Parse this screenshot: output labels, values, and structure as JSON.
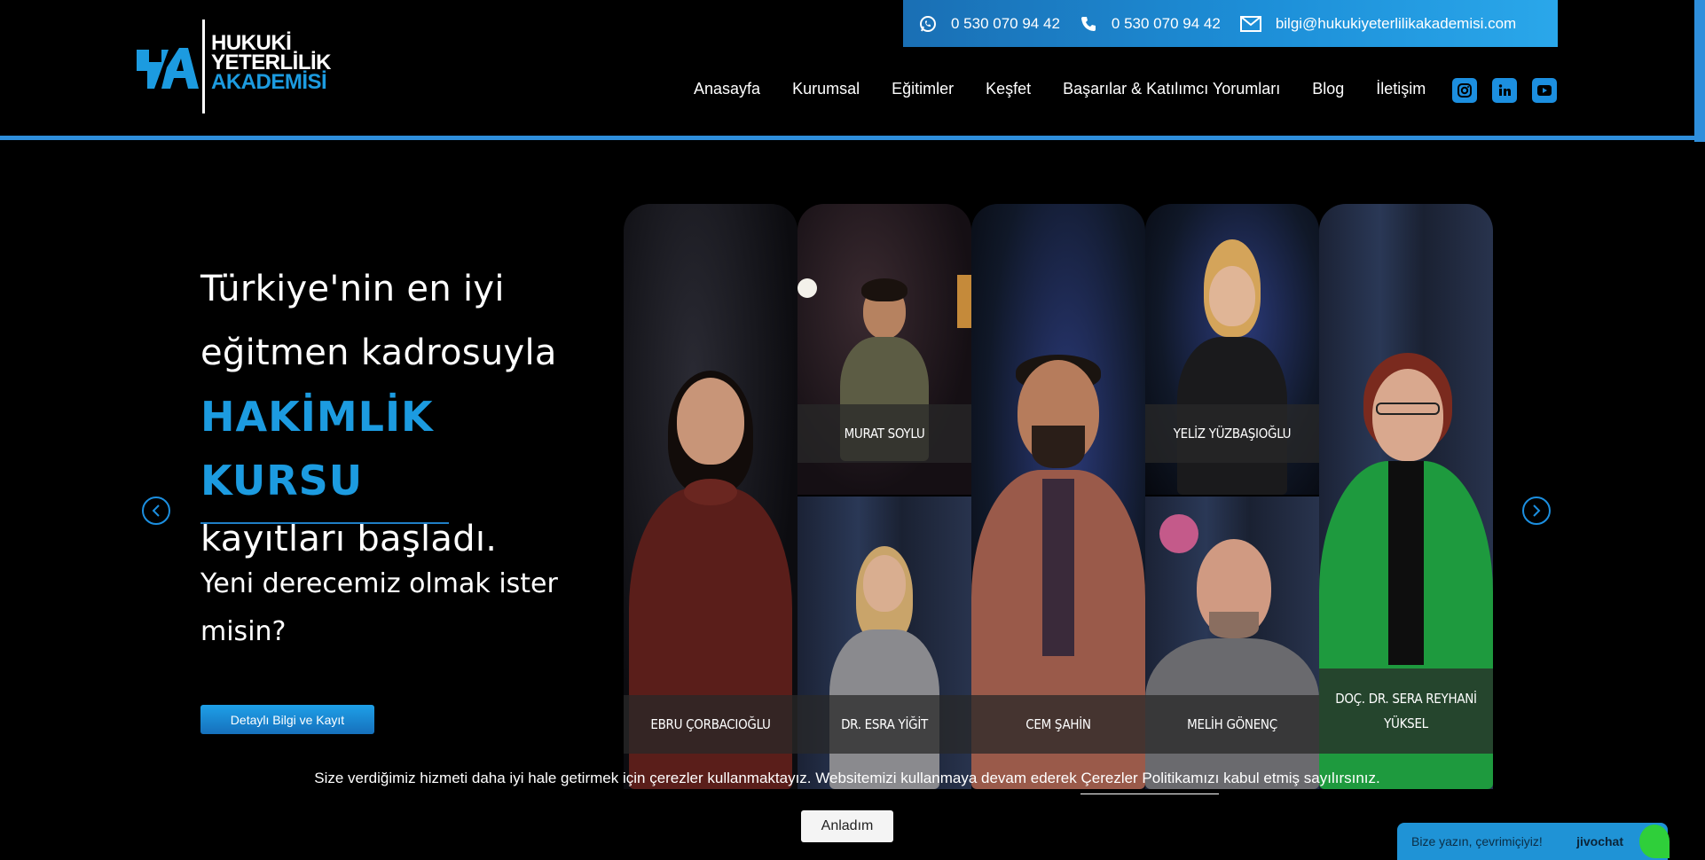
{
  "brand": {
    "logo_lines": [
      "HUKUKİ",
      "YETERLİLİK",
      "AKADEMİSİ"
    ],
    "accent_color": "#1c9be0"
  },
  "contact": {
    "whatsapp": "0 530 070 94 42",
    "phone": "0 530 070 94 42",
    "email": "bilgi@hukukiyeterlilikakademisi.com"
  },
  "nav": {
    "items": [
      "Anasayfa",
      "Kurumsal",
      "Eğitimler",
      "Keşfet",
      "Başarılar & Katılımcı Yorumları",
      "Blog",
      "İletişim"
    ]
  },
  "social": [
    "instagram-icon",
    "linkedin-icon",
    "youtube-icon"
  ],
  "hero": {
    "line1": "Türkiye'nin en iyi",
    "line2": "eğitmen kadrosuyla",
    "accent": "HAKİMLİK KURSU",
    "line3": "kayıtları başladı.",
    "sub": "Yeni derecemiz olmak ister misin?",
    "cta": "Detaylı Bilgi ve Kayıt"
  },
  "instructors": [
    "EBRU ÇORBACIOĞLU",
    "MURAT SOYLU",
    "DR. ESRA YİĞİT",
    "CEM ŞAHİN",
    "YELİZ YÜZBAŞIOĞLU",
    "MELİH GÖNENÇ",
    "DOÇ. DR. SERA REYHANİ YÜKSEL"
  ],
  "cookie": {
    "text_before": "Size verdiğimiz hizmeti daha iyi hale getirmek için çerezler kullanmaktayız. Websitemizi kullanmaya devam ederek ",
    "link": "Çerezler Politikamızı",
    "text_after": " kabul etmiş sayılırsınız.",
    "button": "Anladım"
  },
  "chat": {
    "prompt": "Bize yazın, çevrimiçiyiz!",
    "brand": "jivochat"
  }
}
